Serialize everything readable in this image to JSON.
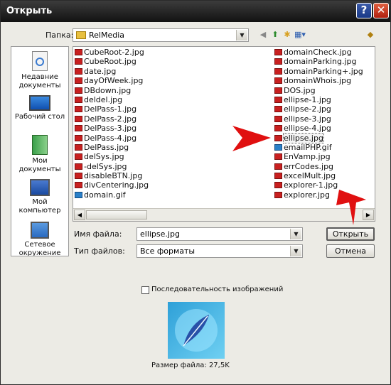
{
  "window": {
    "title": "Открыть",
    "help_glyph": "?",
    "close_glyph": "✕"
  },
  "folder": {
    "label": "Папка:",
    "value": "RelMedia"
  },
  "places": [
    {
      "label": "Недавние документы",
      "icon": "recent-documents-icon"
    },
    {
      "label": "Рабочий стол",
      "icon": "desktop-icon"
    },
    {
      "label": "Мои документы",
      "icon": "my-documents-icon"
    },
    {
      "label": "Мой компьютер",
      "icon": "my-computer-icon"
    },
    {
      "label": "Сетевое окружение",
      "icon": "network-icon"
    }
  ],
  "files_col1": [
    "CubeRoot-2.jpg",
    "CubeRoot.jpg",
    "date.jpg",
    "dayOfWeek.jpg",
    "DBdown.jpg",
    "deldel.jpg",
    "DelPass-1.jpg",
    "DelPass-2.jpg",
    "DelPass-3.jpg",
    "DelPass-4.jpg",
    "DelPass.jpg",
    "delSys.jpg",
    "-delSys.jpg",
    "disableBTN.jpg",
    "divCentering.jpg",
    "domain.gif"
  ],
  "files_col2": [
    "domainCheck.jpg",
    "domainParking.jpg",
    "domainParking+.jpg",
    "domainWhois.jpg",
    "DOS.jpg",
    "ellipse-1.jpg",
    "ellipse-2.jpg",
    "ellipse-3.jpg",
    "ellipse-4.jpg",
    "ellipse.jpg",
    "emailPHP.gif",
    "EnVamp.jpg",
    "errCodes.jpg",
    "excelMult.jpg",
    "explorer-1.jpg",
    "explorer.jpg"
  ],
  "selected_file": "ellipse.jpg",
  "filename": {
    "label": "Имя файла:",
    "value": "ellipse.jpg"
  },
  "filetype": {
    "label": "Тип файлов:",
    "value": "Все форматы"
  },
  "buttons": {
    "open": "Открыть",
    "cancel": "Отмена"
  },
  "sequence_checkbox": {
    "label": "Последовательность изображений",
    "checked": false
  },
  "file_size": "Размер файла: 27,5K",
  "colors": {
    "titlebar": "#1c1c1c",
    "dialog_bg": "#ecebe5",
    "annotation_arrow": "#e01010"
  }
}
